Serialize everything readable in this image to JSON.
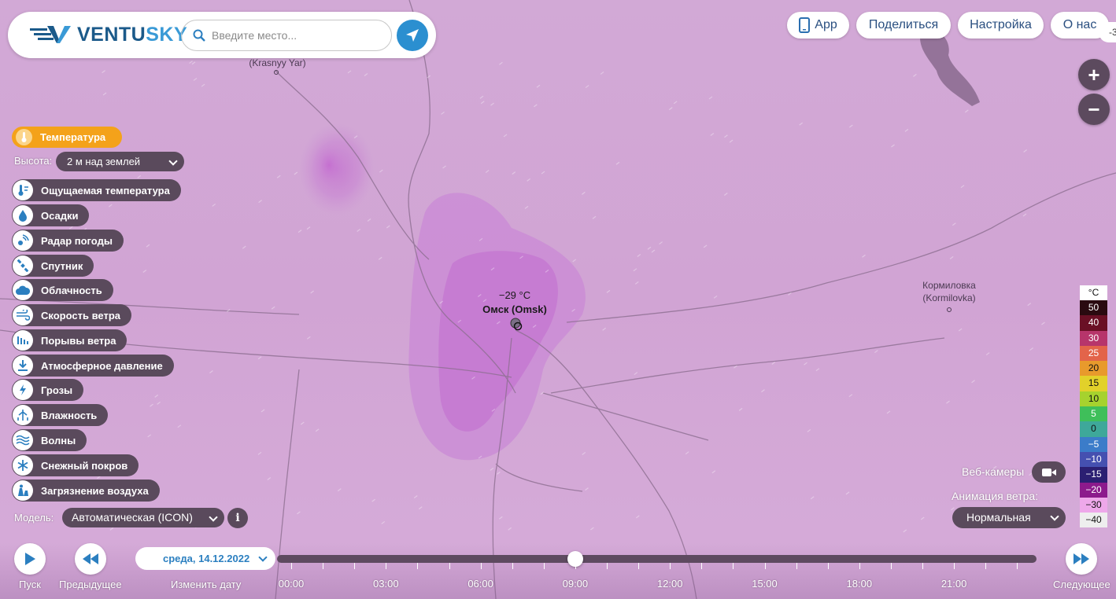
{
  "brand": {
    "logo_text_a": "VENTU",
    "logo_text_b": "SKY"
  },
  "search": {
    "placeholder": "Введите место..."
  },
  "top_nav": {
    "app": "App",
    "share": "Поделиться",
    "settings": "Настройка",
    "about": "О нас",
    "edge_tab": "-3"
  },
  "zoom": {
    "in": "+",
    "out": "−"
  },
  "layers": {
    "active": "Температура",
    "height_label": "Высота:",
    "height_value": "2 м над землей",
    "items": [
      {
        "label": "Ощущаемая температура",
        "icon": "feels-like-icon"
      },
      {
        "label": "Осадки",
        "icon": "precipitation-icon"
      },
      {
        "label": "Радар погоды",
        "icon": "radar-icon"
      },
      {
        "label": "Спутник",
        "icon": "satellite-icon"
      },
      {
        "label": "Облачность",
        "icon": "cloud-icon"
      },
      {
        "label": "Скорость ветра",
        "icon": "wind-icon"
      },
      {
        "label": "Порывы ветра",
        "icon": "gust-icon"
      },
      {
        "label": "Атмосферное давление",
        "icon": "pressure-icon"
      },
      {
        "label": "Грозы",
        "icon": "thunder-icon"
      },
      {
        "label": "Влажность",
        "icon": "humidity-icon"
      },
      {
        "label": "Волны",
        "icon": "waves-icon"
      },
      {
        "label": "Снежный покров",
        "icon": "snow-icon"
      },
      {
        "label": "Загрязнение воздуха",
        "icon": "pollution-icon"
      }
    ],
    "model_label": "Модель:",
    "model_value": "Автоматическая (ICON)",
    "model_info": "i"
  },
  "map": {
    "places": [
      {
        "name": "(Krasnyy Yar)"
      },
      {
        "name_ru": "Кормиловка",
        "name_en": "(Kormilovka)"
      }
    ],
    "omsk": {
      "temp": "−29 °C",
      "name": "Омск (Omsk)"
    }
  },
  "right_panel": {
    "webcams_label": "Веб-камеры",
    "wind_anim_label": "Анимация ветра:",
    "wind_anim_value": "Нормальная"
  },
  "legend": {
    "unit": "°C",
    "items": [
      {
        "v": "50",
        "bg": "#2a0a10",
        "fg": "#fff"
      },
      {
        "v": "40",
        "bg": "#6a1025",
        "fg": "#fff"
      },
      {
        "v": "30",
        "bg": "#b7356b",
        "fg": "#fff"
      },
      {
        "v": "25",
        "bg": "#e3644a",
        "fg": "#fff"
      },
      {
        "v": "20",
        "bg": "#e89a2c",
        "fg": "#111"
      },
      {
        "v": "15",
        "bg": "#e2d12a",
        "fg": "#111"
      },
      {
        "v": "10",
        "bg": "#a6d22e",
        "fg": "#111"
      },
      {
        "v": "5",
        "bg": "#3fbf5a",
        "fg": "#fff"
      },
      {
        "v": "0",
        "bg": "#3ea89a",
        "fg": "#111"
      },
      {
        "v": "−5",
        "bg": "#3b7cc9",
        "fg": "#fff"
      },
      {
        "v": "−10",
        "bg": "#4550b0",
        "fg": "#fff"
      },
      {
        "v": "−15",
        "bg": "#2b1f72",
        "fg": "#fff"
      },
      {
        "v": "−20",
        "bg": "#8c1a8c",
        "fg": "#fff"
      },
      {
        "v": "−30",
        "bg": "#eea8ea",
        "fg": "#111"
      },
      {
        "v": "−40",
        "bg": "#eeeeee",
        "fg": "#111"
      }
    ]
  },
  "timeline": {
    "play_label": "Пуск",
    "prev_label": "Предыдущее",
    "change_date_label": "Изменить дату",
    "next_label": "Следующее",
    "date": "среда, 14.12.2022",
    "current_time": "09:00",
    "times": [
      "00:00",
      "03:00",
      "06:00",
      "09:00",
      "12:00",
      "15:00",
      "18:00",
      "21:00"
    ]
  }
}
